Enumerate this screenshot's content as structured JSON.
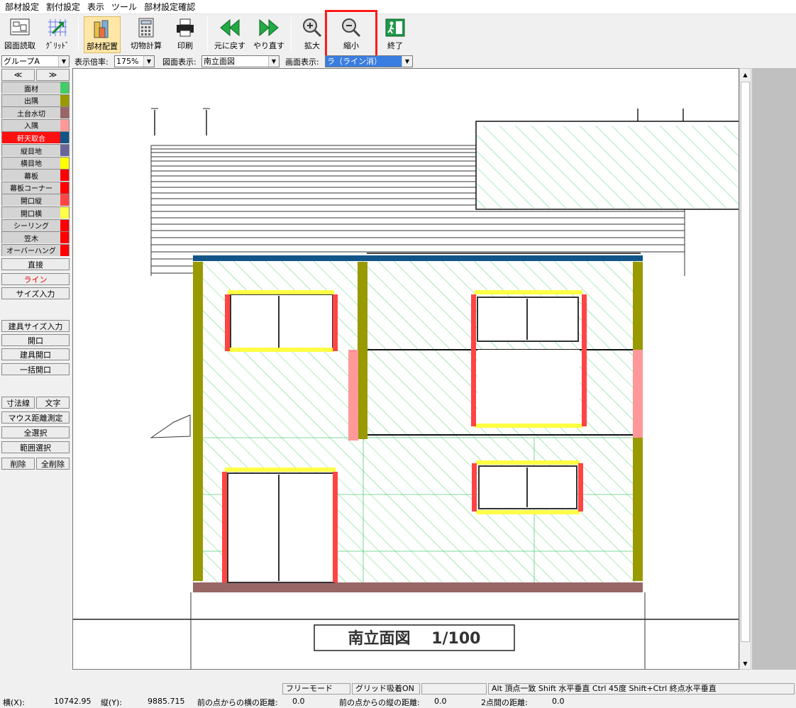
{
  "menu": [
    "部材設定",
    "割付設定",
    "表示",
    "ツール",
    "部材設定確認"
  ],
  "toolbar": {
    "load_drawing": "図面読取",
    "grid": "ｸﾞﾘｯﾄﾞ",
    "place_material": "部材配置",
    "cut_calc": "切物計算",
    "print": "印刷",
    "undo": "元に戻す",
    "redo": "やり直す",
    "zoom_in": "拡大",
    "zoom_out": "縮小",
    "exit": "終了"
  },
  "selectors": {
    "group": "グループA",
    "scale_label": "表示倍率:",
    "scale": "175%",
    "view_label": "図面表示:",
    "view": "南立面図",
    "screen_label": "画面表示:",
    "screen": "ラ（ライン消）"
  },
  "panel": {
    "prev": "≪",
    "next": "≫",
    "materials": [
      {
        "name": "面材",
        "color": "#44cc66"
      },
      {
        "name": "出隅",
        "color": "#999900"
      },
      {
        "name": "土台水切",
        "color": "#996666"
      },
      {
        "name": "入隅",
        "color": "#ff9999"
      },
      {
        "name": "軒天取合",
        "color": "#115588"
      },
      {
        "name": "縦目地",
        "color": "#666699"
      },
      {
        "name": "横目地",
        "color": "#ffff00"
      },
      {
        "name": "幕板",
        "color": "#ff0000"
      },
      {
        "name": "幕板コーナー",
        "color": "#ff0000"
      },
      {
        "name": "開口縦",
        "color": "#ff4444"
      },
      {
        "name": "開口横",
        "color": "#ffff44"
      },
      {
        "name": "シーリング",
        "color": "#ff0000"
      },
      {
        "name": "笠木",
        "color": "#ff0000"
      },
      {
        "name": "オーバーハング",
        "color": "#ff0000"
      }
    ],
    "direct": "直接",
    "line": "ライン",
    "size_input": "サイズ入力",
    "fitting_size": "建具サイズ入力",
    "opening": "開口",
    "fitting_opening": "建具開口",
    "batch_opening": "一括開口",
    "dimension": "寸法線",
    "text": "文字",
    "measure": "マウス距離測定",
    "select_all": "全選択",
    "range_select": "範囲選択",
    "delete": "削除",
    "delete_all": "全削除"
  },
  "drawing": {
    "title": "南立面図　 1/100"
  },
  "status": {
    "free_mode": "フリーモード",
    "grid_snap": "グリッド吸着ON",
    "hint": "Alt 頂点一致  Shift 水平垂直  Ctrl 45度  Shift+Ctrl 終点水平垂直",
    "x_label": "横(X):",
    "x_value": "10742.95",
    "y_label": "縦(Y):",
    "y_value": "9885.715",
    "dx_label": "前の点からの横の距離:",
    "dx_value": "0.0",
    "dy_label": "前の点からの縦の距離:",
    "dy_value": "0.0",
    "dist_label": "2点間の距離:",
    "dist_value": "0.0"
  }
}
